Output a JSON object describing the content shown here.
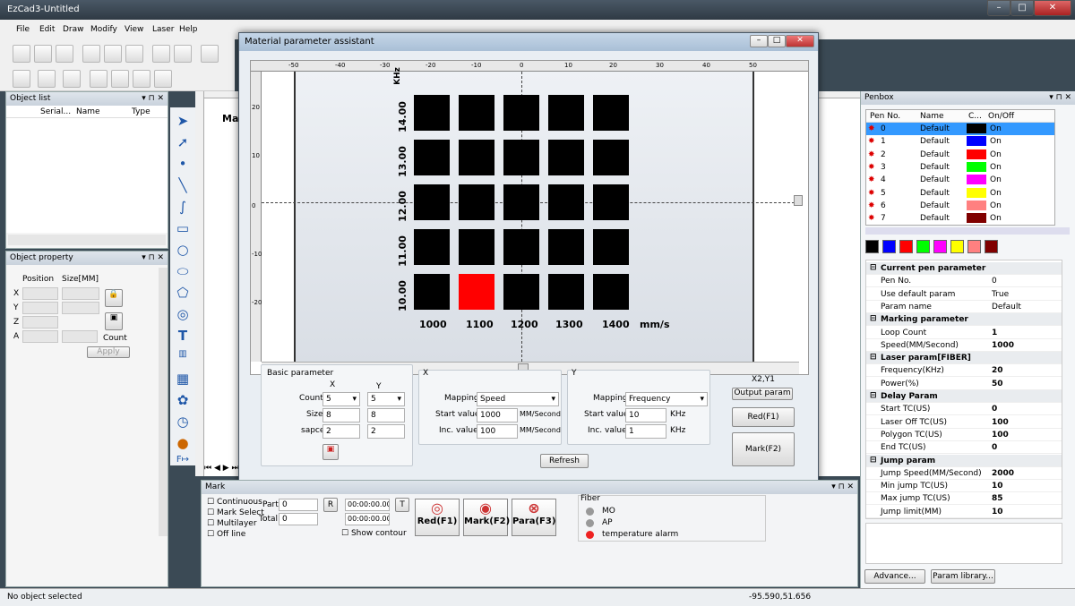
{
  "window": {
    "title": "EzCad3-Untitled"
  },
  "menu": [
    "File",
    "Edit",
    "Draw",
    "Modify",
    "View",
    "Laser",
    "Help"
  ],
  "object_list": {
    "title": "Object list",
    "columns": [
      "Serial...",
      "Name",
      "Type"
    ]
  },
  "object_property": {
    "title": "Object property",
    "position_label": "Position",
    "size_label": "Size[MM]",
    "axes": [
      "X",
      "Y",
      "Z",
      "A"
    ],
    "count_label": "Count",
    "apply_label": "Apply"
  },
  "dialog": {
    "title": "Material parameter assistant",
    "top_ruler": [
      "-50",
      "-40",
      "-30",
      "-20",
      "-10",
      "0",
      "10",
      "20",
      "30",
      "40",
      "50"
    ],
    "left_ruler": [
      "20",
      "10",
      "0",
      "-10",
      "-20"
    ],
    "y_axis_unit": "KHz",
    "y_labels": [
      "14.00",
      "13.00",
      "12.00",
      "11.00",
      "10.00"
    ],
    "x_labels": [
      "1000",
      "1100",
      "1200",
      "1300",
      "1400"
    ],
    "x_axis_unit": "mm/s",
    "basic": {
      "title": "Basic parameter",
      "x_header": "X",
      "y_header": "Y",
      "count_label": "Count",
      "count_x": "5",
      "count_y": "5",
      "size_label": "Size",
      "size_x": "8",
      "size_y": "8",
      "space_label": "sapce",
      "space_x": "2",
      "space_y": "2"
    },
    "x_group": {
      "title": "X",
      "mapping_label": "Mapping",
      "mapping": "Speed",
      "start_label": "Start value",
      "start": "1000",
      "start_unit": "MM/Second",
      "inc_label": "Inc. value",
      "inc": "100",
      "inc_unit": "MM/Second"
    },
    "y_group": {
      "title": "Y",
      "mapping_label": "Mapping",
      "mapping": "Frequency",
      "start_label": "Start value",
      "start": "10",
      "start_unit": "KHz",
      "inc_label": "Inc. value",
      "inc": "1",
      "inc_unit": "KHz"
    },
    "selected_cell": "X2,Y1",
    "output_label": "Output param",
    "red_label": "Red(F1)",
    "mark_label": "Mark(F2)",
    "refresh_label": "Refresh"
  },
  "penbox": {
    "title": "Penbox",
    "columns": [
      "Pen No.",
      "Name",
      "C...",
      "On/Off"
    ],
    "pens": [
      {
        "no": "0",
        "name": "Default",
        "color": "#000000",
        "state": "On"
      },
      {
        "no": "1",
        "name": "Default",
        "color": "#0000ff",
        "state": "On"
      },
      {
        "no": "2",
        "name": "Default",
        "color": "#ff0000",
        "state": "On"
      },
      {
        "no": "3",
        "name": "Default",
        "color": "#00ff00",
        "state": "On"
      },
      {
        "no": "4",
        "name": "Default",
        "color": "#ff00ff",
        "state": "On"
      },
      {
        "no": "5",
        "name": "Default",
        "color": "#ffff00",
        "state": "On"
      },
      {
        "no": "6",
        "name": "Default",
        "color": "#ff8080",
        "state": "On"
      },
      {
        "no": "7",
        "name": "Default",
        "color": "#800000",
        "state": "On"
      }
    ],
    "swatches": [
      "#000000",
      "#0000ff",
      "#ff0000",
      "#00ff00",
      "#ff00ff",
      "#ffff00",
      "#ff8080",
      "#800000"
    ],
    "props": [
      {
        "k": "Current pen parameter",
        "v": "",
        "sec": true
      },
      {
        "k": "Pen No.",
        "v": "0"
      },
      {
        "k": "Use default param",
        "v": "True"
      },
      {
        "k": "Param name",
        "v": "Default"
      },
      {
        "k": "Marking parameter",
        "v": "",
        "sec": true
      },
      {
        "k": "Loop Count",
        "v": "1"
      },
      {
        "k": "Speed(MM/Second)",
        "v": "1000"
      },
      {
        "k": "Laser param[FIBER]",
        "v": "",
        "sec": true
      },
      {
        "k": "Frequency(KHz)",
        "v": "20"
      },
      {
        "k": "Power(%)",
        "v": "50"
      },
      {
        "k": "Delay Param",
        "v": "",
        "sec": true
      },
      {
        "k": "Start TC(US)",
        "v": "0"
      },
      {
        "k": "Laser Off TC(US)",
        "v": "100"
      },
      {
        "k": "Polygon TC(US)",
        "v": "100"
      },
      {
        "k": "End TC(US)",
        "v": "0"
      },
      {
        "k": "Jump param",
        "v": "",
        "sec": true
      },
      {
        "k": "Jump Speed(MM/Second)",
        "v": "2000"
      },
      {
        "k": "Min jump TC(US)",
        "v": "10"
      },
      {
        "k": "Max jump TC(US)",
        "v": "85"
      },
      {
        "k": "Jump limit(MM)",
        "v": "10"
      }
    ],
    "advance_label": "Advance...",
    "library_label": "Param library..."
  },
  "mark_panel": {
    "title": "Mark",
    "continuous": "Continuous",
    "mark_select": "Mark Select",
    "multilayer": "Multilayer",
    "off_line": "Off line",
    "part_label": "Part",
    "part": "0",
    "total_label": "Total",
    "total": "0",
    "r_label": "R",
    "t_label": "T",
    "time1": "00:00:00.000",
    "time2": "00:00:00.000",
    "show_contour": "Show contour",
    "red_btn": "Red(F1)",
    "mark_btn": "Mark(F2)",
    "para_btn": "Para(F3)",
    "fiber_title": "Fiber",
    "mo": "MO",
    "ap": "AP",
    "temp": "temperature alarm"
  },
  "status": {
    "left": "No object selected",
    "coords": "-95.590,51.656"
  },
  "canvas_text": "Ma"
}
